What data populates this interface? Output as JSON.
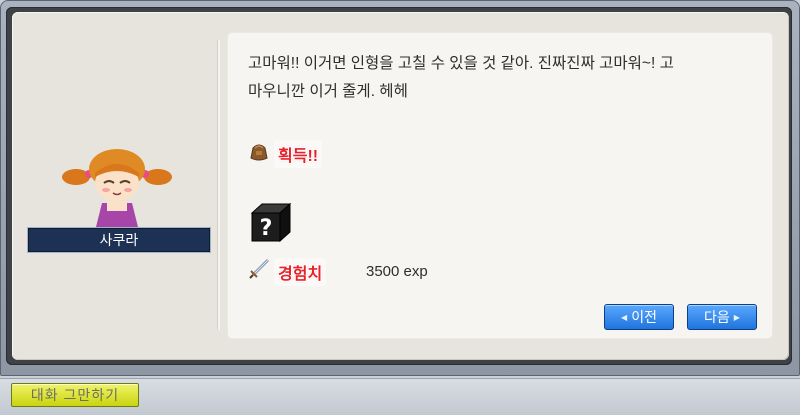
{
  "npc": {
    "name": "사쿠라"
  },
  "dialogue": {
    "line1": "고마워!! 이거면 인형을 고칠 수 있을 것 같아. 진짜진짜 고마워~! 고",
    "line2": "마우니깐 이거 줄게. 헤헤"
  },
  "rewards": {
    "obtain_label": "획득!!",
    "item_icon": "mystery-item-icon",
    "exp_label": "경험치",
    "exp_value": "3500 exp"
  },
  "buttons": {
    "prev_label": "이전",
    "next_label": "다음",
    "end_chat_label": "대화 그만하기"
  },
  "colors": {
    "nameplate_bg": "#1d3154",
    "nav_button": "#2a80e8",
    "reward_label": "#e8202a",
    "end_chat_button": "#dde431"
  }
}
